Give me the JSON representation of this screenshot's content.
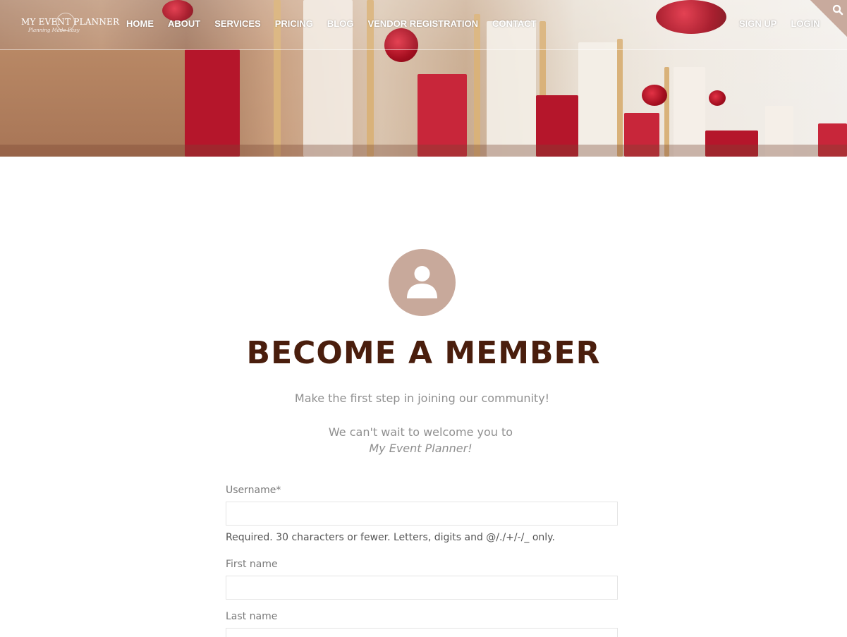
{
  "brand": {
    "name": "MY EVENT PLANNER",
    "tagline": "Planning Made Easy"
  },
  "nav": {
    "items": [
      "HOME",
      "ABOUT",
      "SERVICES",
      "PRICING",
      "BLOG",
      "VENDOR REGISTRATION",
      "CONTACT"
    ],
    "sign_up": "SIGN UP",
    "login": "LOGIN"
  },
  "colors": {
    "accent": "#c8a99b",
    "title": "#4a1e0d",
    "muted_text": "#8f8f8f"
  },
  "icons": {
    "search": "search-icon",
    "avatar": "user-icon"
  },
  "page": {
    "title": "BECOME A MEMBER",
    "subtitle": "Make the first step in joining our community!",
    "welcome_line": "We can't wait to welcome you to",
    "welcome_brand": "My Event Planner!"
  },
  "form": {
    "username_label": "Username*",
    "username_value": "",
    "username_help": "Required. 30 characters or fewer. Letters, digits and @/./+/-/_ only.",
    "first_name_label": "First name",
    "first_name_value": "",
    "last_name_label": "Last name",
    "last_name_value": ""
  }
}
